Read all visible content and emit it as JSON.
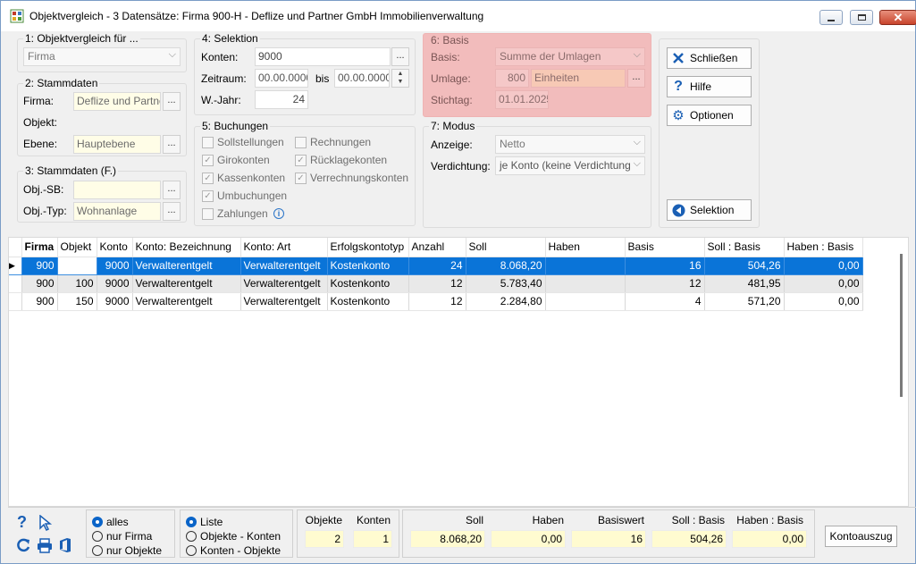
{
  "window": {
    "title": "Objektvergleich - 3 Datensätze:  Firma 900-H - Deflize und Partner GmbH Immobilienverwaltung"
  },
  "g1": {
    "title": "1: Objektvergleich für ...",
    "select": "Firma"
  },
  "g2": {
    "title": "2: Stammdaten",
    "firma_label": "Firma:",
    "firma_value": "Deflize und Partne",
    "objekt_label": "Objekt:",
    "ebene_label": "Ebene:",
    "ebene_value": "Hauptebene"
  },
  "g3": {
    "title": "3: Stammdaten (F.)",
    "objsb_label": "Obj.-SB:",
    "objsb_value": "",
    "objtyp_label": "Obj.-Typ:",
    "objtyp_value": "Wohnanlage"
  },
  "g4": {
    "title": "4: Selektion",
    "konten_label": "Konten:",
    "konten_value": "9000",
    "zeitraum_label": "Zeitraum:",
    "zeitraum_from": "00.00.0000",
    "bis_label": "bis",
    "zeitraum_to": "00.00.0000",
    "wjahr_label": "W.-Jahr:",
    "wjahr_value": "24"
  },
  "g5": {
    "title": "5: Buchungen",
    "items": [
      "Sollstellungen",
      "Rechnungen",
      "Girokonten",
      "Rücklagekonten",
      "Kassenkonten",
      "Verrechnungskonten",
      "Umbuchungen",
      "Zahlungen"
    ]
  },
  "g6": {
    "title": "6: Basis",
    "basis_label": "Basis:",
    "basis_value": "Summe der Umlagen",
    "umlage_label": "Umlage:",
    "umlage_num": "800",
    "umlage_text": "Einheiten",
    "stichtag_label": "Stichtag:",
    "stichtag_value": "01.01.2025"
  },
  "g7": {
    "title": "7: Modus",
    "anzeige_label": "Anzeige:",
    "anzeige_value": "Netto",
    "verdichtung_label": "Verdichtung:",
    "verdichtung_value": "je Konto (keine Verdichtung"
  },
  "buttons": {
    "close": "Schließen",
    "help": "Hilfe",
    "options": "Optionen",
    "selection": "Selektion",
    "kontoauszug": "Kontoauszug"
  },
  "table": {
    "columns": [
      "Firma",
      "Objekt",
      "Konto",
      "Konto: Bezeichnung",
      "Konto: Art",
      "Erfolgskontotyp",
      "Anzahl",
      "Soll",
      "Haben",
      "Basis",
      "Soll : Basis",
      "Haben : Basis"
    ],
    "rows": [
      [
        "900",
        "",
        "9000",
        "Verwalterentgelt",
        "Verwalterentgelt",
        "Kostenkonto",
        "24",
        "8.068,20",
        "",
        "16",
        "504,26",
        "0,00"
      ],
      [
        "900",
        "100",
        "9000",
        "Verwalterentgelt",
        "Verwalterentgelt",
        "Kostenkonto",
        "12",
        "5.783,40",
        "",
        "12",
        "481,95",
        "0,00"
      ],
      [
        "900",
        "150",
        "9000",
        "Verwalterentgelt",
        "Verwalterentgelt",
        "Kostenkonto",
        "12",
        "2.284,80",
        "",
        "4",
        "571,20",
        "0,00"
      ]
    ]
  },
  "filter1": {
    "options": [
      "alles",
      "nur Firma",
      "nur Objekte"
    ],
    "selected": "alles"
  },
  "filter2": {
    "options": [
      "Liste",
      "Objekte - Konten",
      "Konten - Objekte"
    ],
    "selected": "Liste"
  },
  "summary": {
    "objekte_label": "Objekte",
    "objekte_value": "2",
    "konten_label": "Konten",
    "konten_value": "1",
    "soll_label": "Soll",
    "soll_value": "8.068,20",
    "haben_label": "Haben",
    "haben_value": "0,00",
    "basiswert_label": "Basiswert",
    "basiswert_value": "16",
    "sollbasis_label": "Soll : Basis",
    "sollbasis_value": "504,26",
    "habenbasis_label": "Haben : Basis",
    "habenbasis_value": "0,00"
  }
}
